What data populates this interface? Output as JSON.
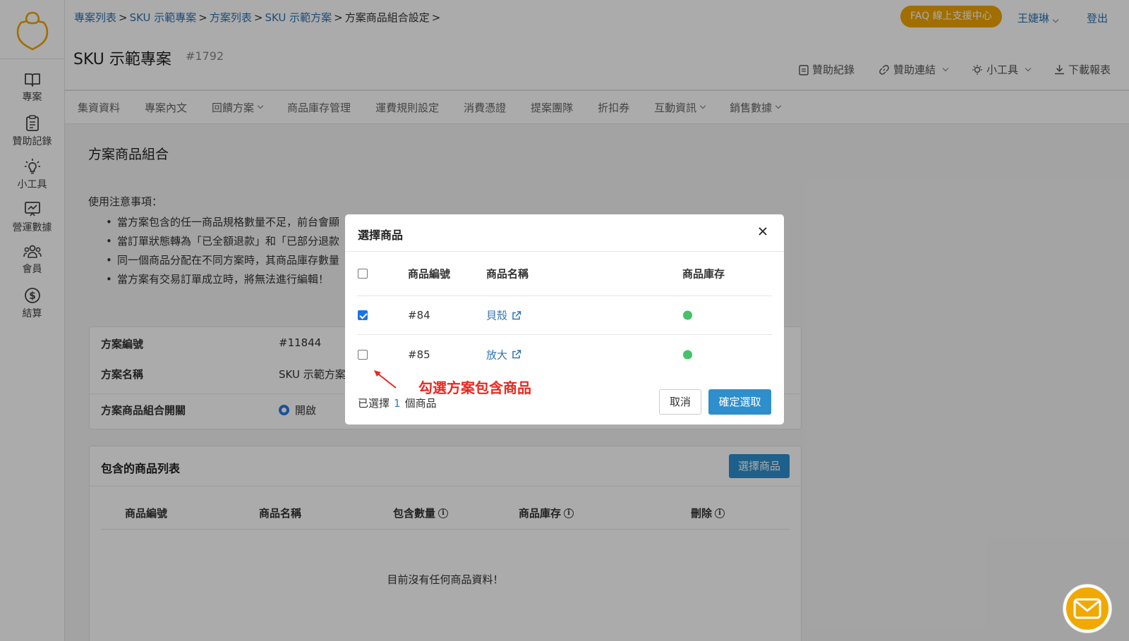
{
  "breadcrumb": {
    "items": [
      "專案列表",
      "SKU 示範專案",
      "方案列表",
      "SKU 示範方案"
    ],
    "current": "方案商品組合設定",
    "separator": ">"
  },
  "header": {
    "faq": "FAQ 線上支援中心",
    "user": "王婕琳",
    "logout": "登出",
    "project_title": "SKU 示範專案",
    "project_id": "#1792",
    "tools": [
      "贊助紀錄",
      "贊助連結",
      "小工具",
      "下載報表"
    ]
  },
  "sidebar": {
    "items": [
      "專案",
      "贊助記錄",
      "小工具",
      "營運數據",
      "會員",
      "結算"
    ]
  },
  "nav": {
    "tabs": [
      "集資資料",
      "專案內文",
      "回饋方案",
      "商品庫存管理",
      "運費規則設定",
      "消費憑證",
      "提案團隊",
      "折扣券",
      "互動資訊",
      "銷售數據"
    ]
  },
  "page": {
    "title": "方案商品組合",
    "notice_title": "使用注意事項：",
    "notices": [
      "當方案包含的任一商品規格數量不足，前台會顯示",
      "當訂單狀態轉為「已全額退款」和「已部分退款」",
      "同一個商品分配在不同方案時，其商品庫存數量",
      "當方案有交易訂單成立時，將無法進行編輯！"
    ]
  },
  "plan_info": {
    "id_label": "方案編號",
    "id_value": "#11844",
    "name_label": "方案名稱",
    "name_value": "SKU 示範方案",
    "toggle_label": "方案商品組合開關",
    "toggle_value": "開啟"
  },
  "product_list": {
    "title": "包含的商品列表",
    "choose_button": "選擇商品",
    "columns": [
      "商品編號",
      "商品名稱",
      "包含數量",
      "商品庫存",
      "刪除"
    ],
    "empty": "目前沒有任何商品資料！"
  },
  "modal": {
    "title": "選擇商品",
    "columns": [
      "商品編號",
      "商品名稱",
      "商品庫存"
    ],
    "rows": [
      {
        "id": "#84",
        "name": "貝殼",
        "checked": true,
        "stock_color": "#45c26a"
      },
      {
        "id": "#85",
        "name": "放大",
        "checked": false,
        "stock_color": "#45c26a"
      }
    ],
    "annotation": "勾選方案包含商品",
    "selected_prefix": "已選擇",
    "selected_count": "1",
    "selected_suffix": "個商品",
    "cancel": "取消",
    "confirm": "確定選取"
  },
  "colors": {
    "accent": "#2e8fcc",
    "faq": "#f0a500",
    "link": "#2f73b0",
    "stock_ok": "#45c26a",
    "annotation": "#e8291f"
  }
}
